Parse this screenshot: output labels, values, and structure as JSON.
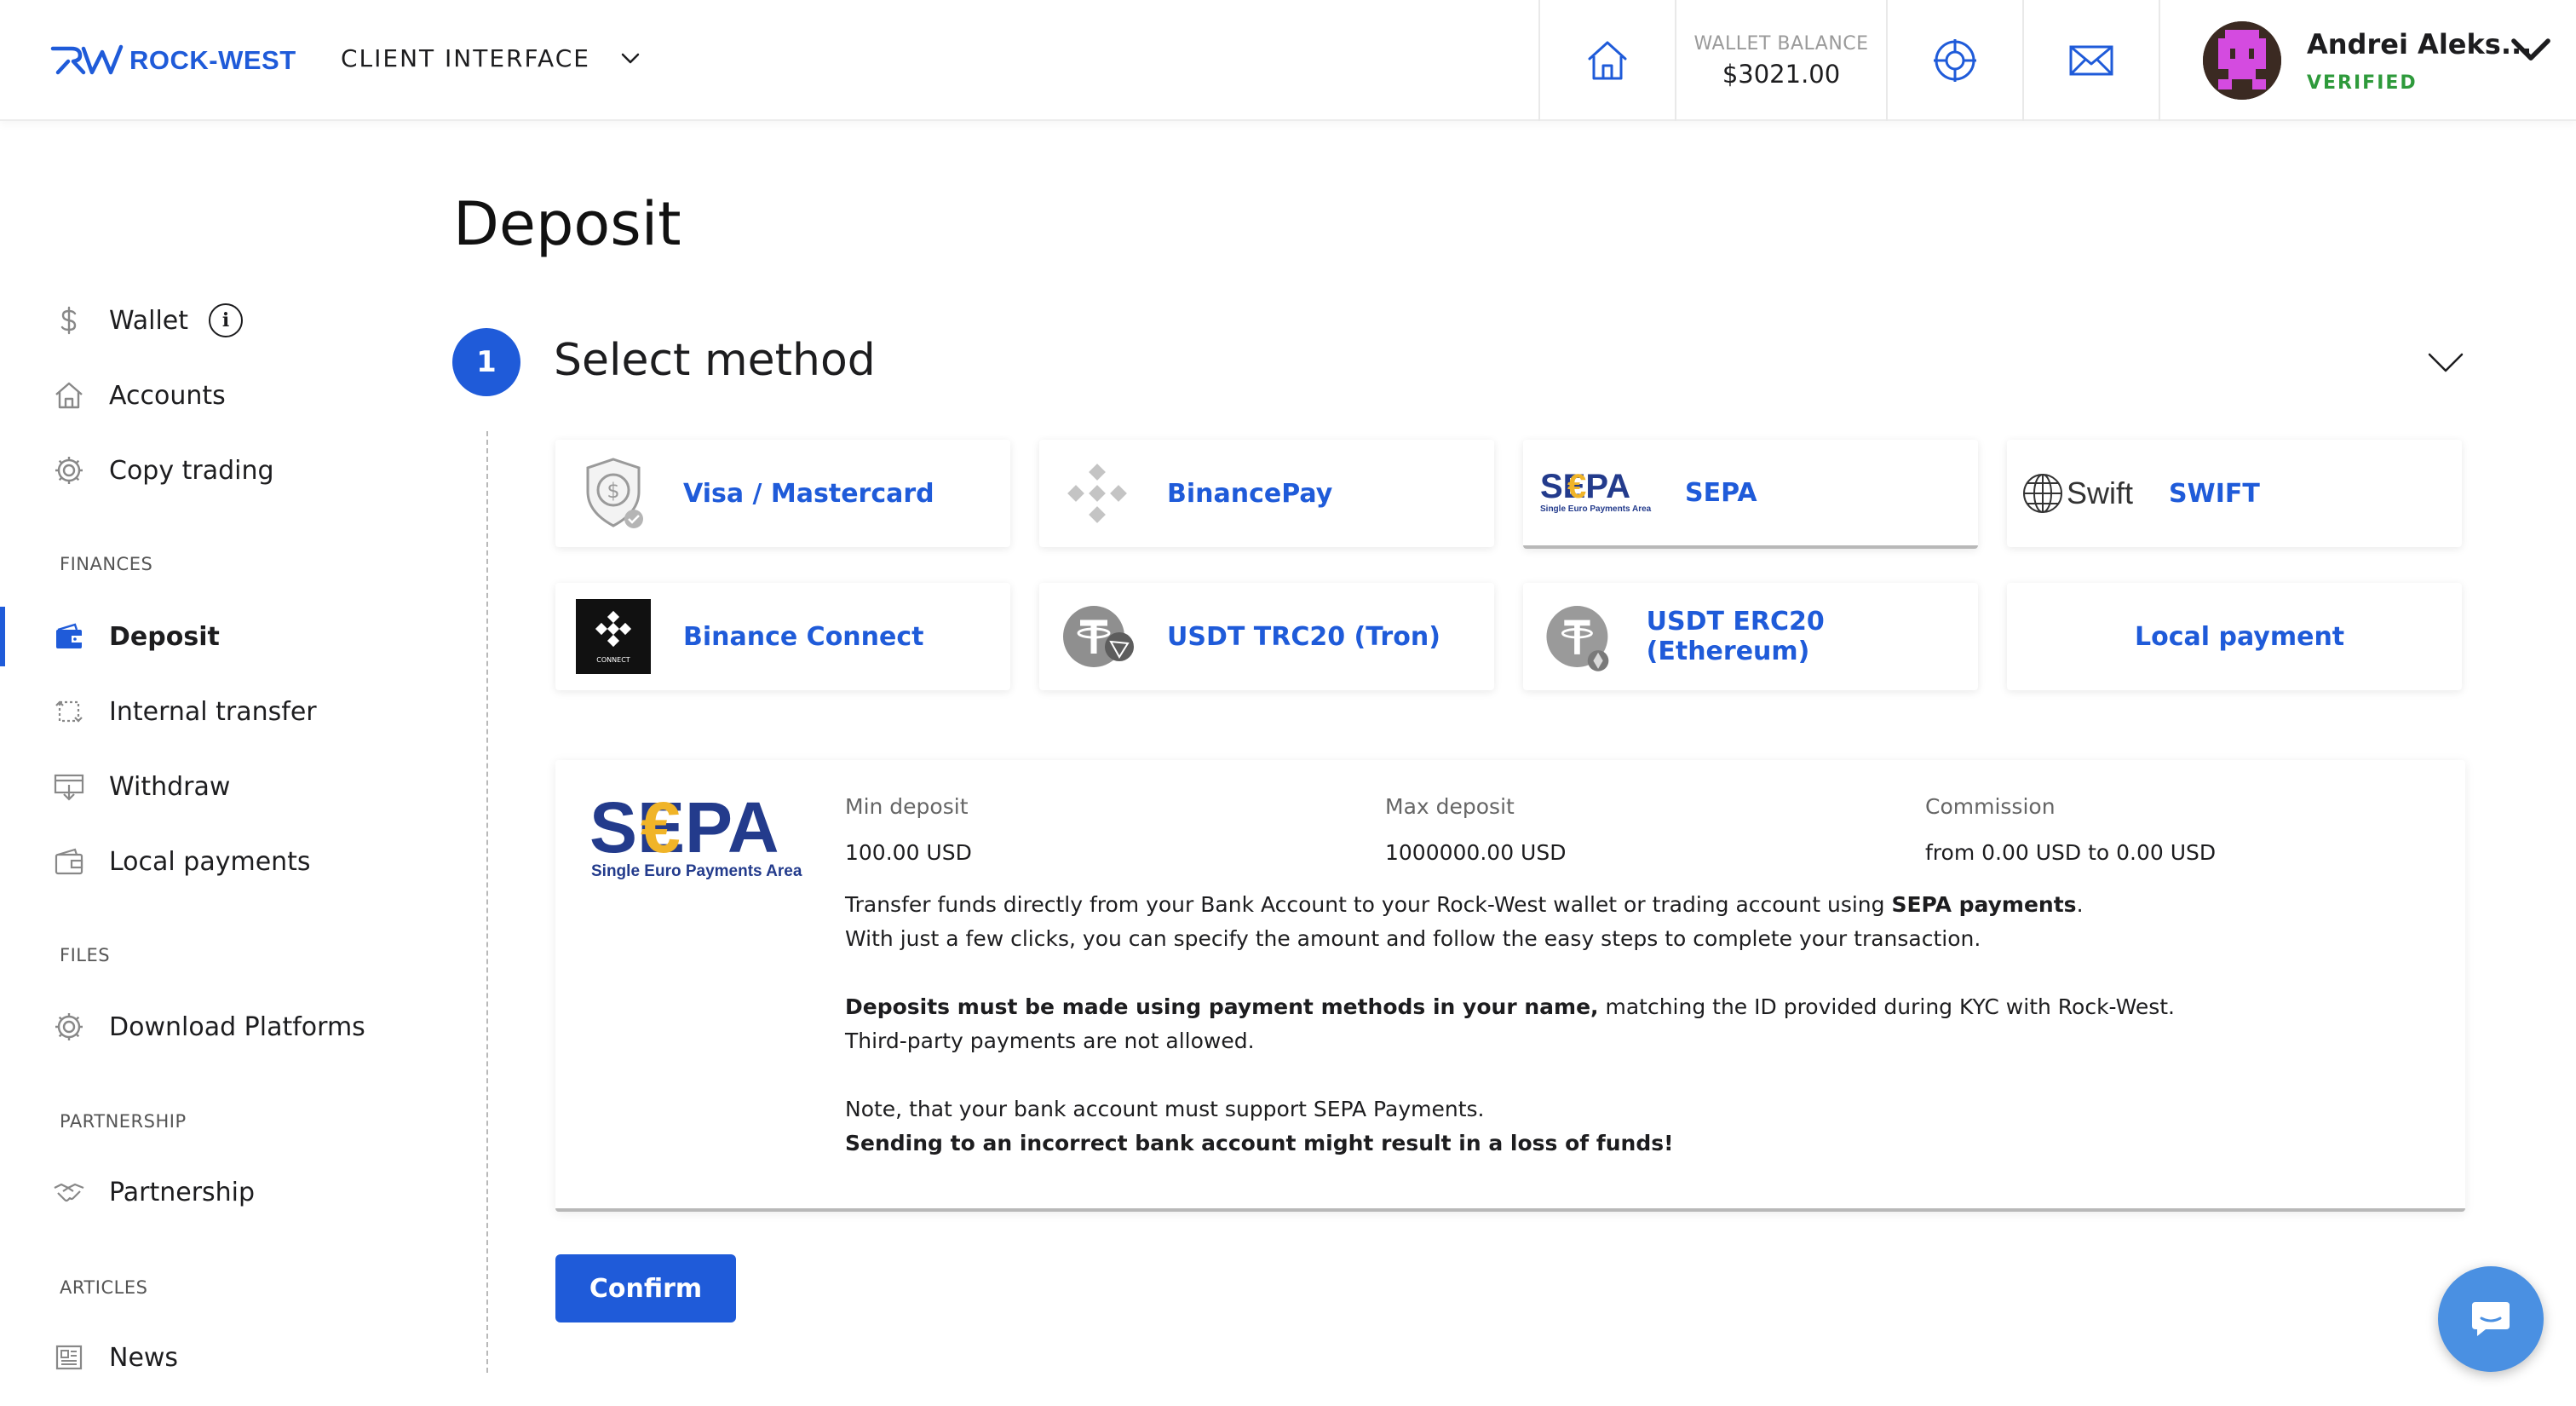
{
  "brand": {
    "name": "ROCK-WEST",
    "color": "#1f5bd9"
  },
  "header": {
    "client_interface_label": "CLIENT INTERFACE",
    "wallet_balance_label": "WALLET BALANCE",
    "wallet_balance_value": "$3021.00",
    "user_name": "Andrei Aleks...",
    "user_status": "VERIFIED",
    "icons": [
      "home-icon",
      "support-icon",
      "mail-icon"
    ]
  },
  "sidebar": {
    "main_items": [
      {
        "label": "Wallet",
        "icon": "dollar-icon",
        "info": "i"
      },
      {
        "label": "Accounts",
        "icon": "home-icon"
      },
      {
        "label": "Copy trading",
        "icon": "gear-icon"
      }
    ],
    "sections": {
      "finances": "FINANCES",
      "files": "FILES",
      "partnership": "PARTNERSHIP",
      "articles": "ARTICLES"
    },
    "finance_items": [
      {
        "label": "Deposit",
        "icon": "wallet-icon",
        "active": true
      },
      {
        "label": "Internal transfer",
        "icon": "transfer-icon"
      },
      {
        "label": "Withdraw",
        "icon": "withdraw-icon"
      },
      {
        "label": "Local payments",
        "icon": "local-wallet-icon"
      }
    ],
    "file_items": [
      {
        "label": "Download Platforms",
        "icon": "gear-icon"
      }
    ],
    "partnership_items": [
      {
        "label": "Partnership",
        "icon": "handshake-icon"
      }
    ],
    "article_items": [
      {
        "label": "News",
        "icon": "newspaper-icon"
      }
    ]
  },
  "main": {
    "title": "Deposit",
    "step": {
      "number": "1",
      "title": "Select method"
    },
    "methods": [
      {
        "label": "Visa / Mastercard",
        "icon": "shield-dollar-icon"
      },
      {
        "label": "BinancePay",
        "icon": "binance-icon"
      },
      {
        "label": "SEPA",
        "icon": "sepa-logo",
        "selected": true
      },
      {
        "label": "SWIFT",
        "icon": "swift-logo"
      },
      {
        "label": "Binance Connect",
        "icon": "binance-connect-icon"
      },
      {
        "label": "USDT TRC20 (Tron)",
        "icon": "tether-tron-icon"
      },
      {
        "label": "USDT ERC20 (Ethereum)",
        "icon": "tether-eth-icon"
      },
      {
        "label": "Local payment",
        "icon": ""
      }
    ],
    "method_logo_text": {
      "sepa": "SEPA",
      "sepa_sub": "Single Euro Payments Area",
      "swift": "Swift",
      "connect": "CONNECT"
    },
    "details": {
      "min_deposit_label": "Min deposit",
      "min_deposit_value": "100.00 USD",
      "max_deposit_label": "Max deposit",
      "max_deposit_value": "1000000.00 USD",
      "commission_label": "Commission",
      "commission_value": "from 0.00 USD to 0.00 USD",
      "line1_a": "Transfer funds directly from your Bank Account to your Rock-West wallet or trading account using ",
      "line1_b": "SEPA payments",
      "line1_c": ".",
      "line2": "With just a few clicks, you can specify the amount and follow the easy steps to complete your transaction.",
      "line3_a": "Deposits must be made using payment methods in your name,",
      "line3_b": " matching the ID provided during KYC with Rock-West.",
      "line4": "Third-party payments are not allowed.",
      "line5": "Note, that your bank account must support SEPA Payments.",
      "line6": "Sending to an incorrect bank account might result in a loss of funds!"
    },
    "confirm_label": "Confirm"
  },
  "colors": {
    "accent": "#1f5bd9",
    "verified": "#2e9a3b",
    "chat": "#4a90e2"
  }
}
